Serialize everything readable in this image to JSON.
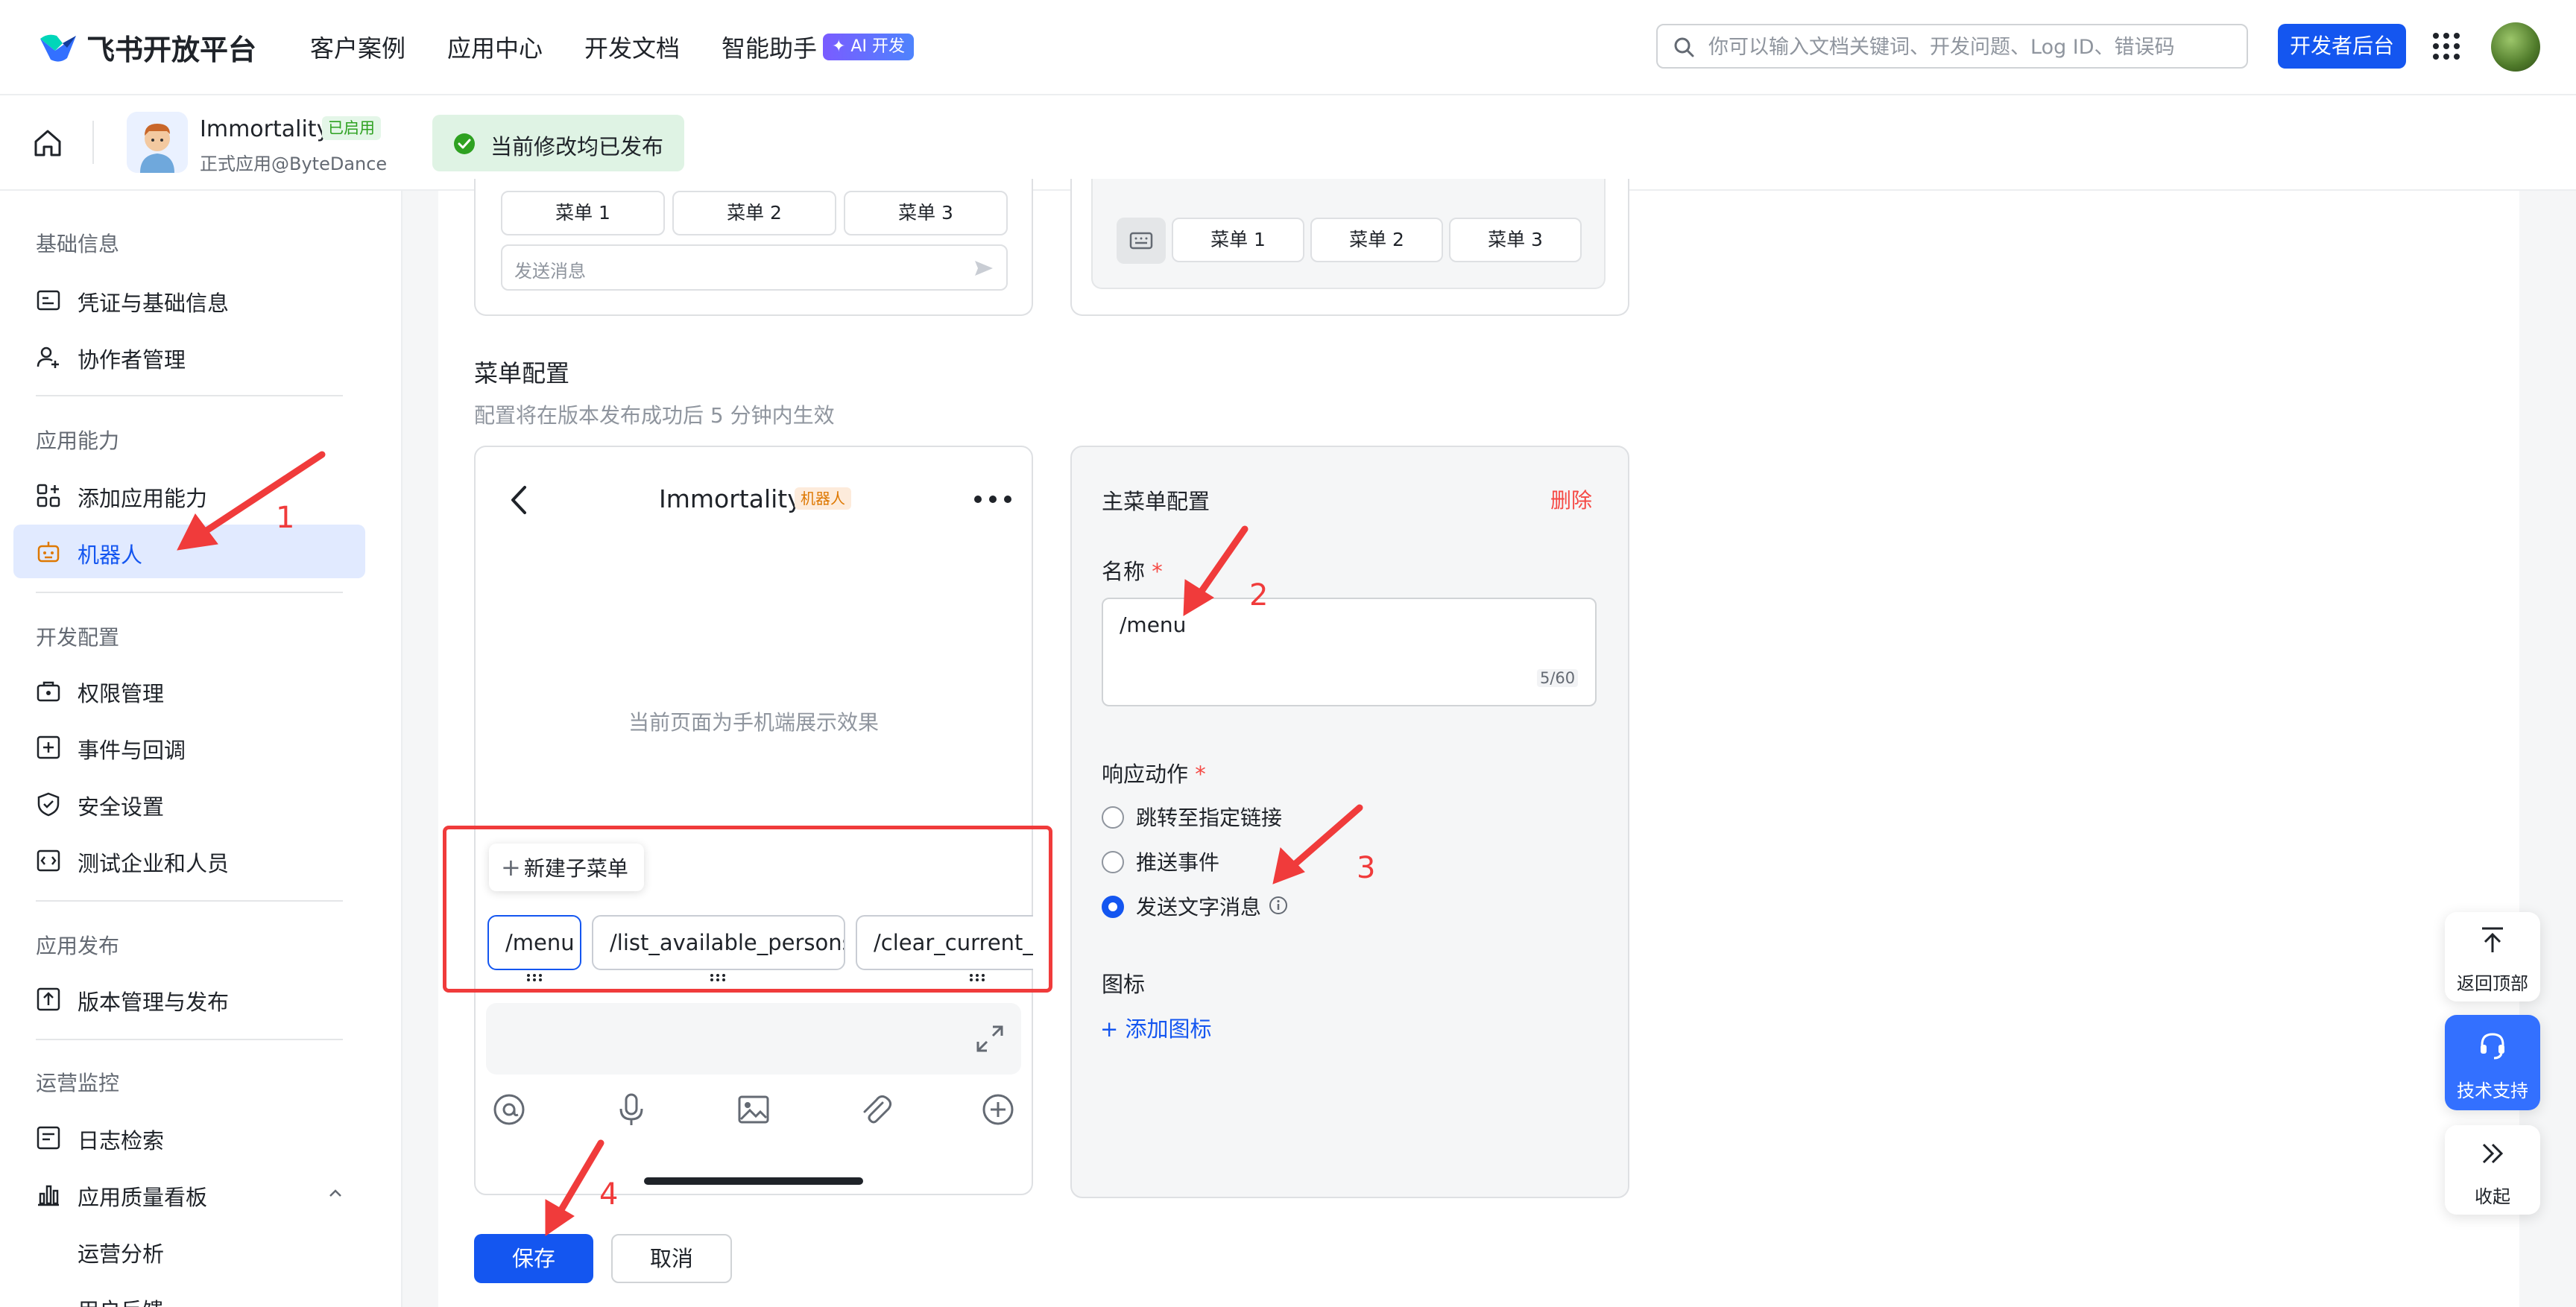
{
  "topnav": {
    "brand": "飞书开放平台",
    "links": [
      "客户案例",
      "应用中心",
      "开发文档",
      "智能助手"
    ],
    "ai_badge": "✦ AI 开发",
    "search_placeholder": "你可以输入文档关键词、开发问题、Log ID、错误码",
    "dev_console": "开发者后台"
  },
  "appbar": {
    "app_name": "Immortality",
    "status": "已启用",
    "subtitle": "正式应用@ByteDance",
    "published_msg": "当前修改均已发布"
  },
  "sidebar": {
    "sections": [
      {
        "title": "基础信息",
        "items": [
          "凭证与基础信息",
          "协作者管理"
        ]
      },
      {
        "title": "应用能力",
        "items": [
          "添加应用能力",
          "机器人"
        ]
      },
      {
        "title": "开发配置",
        "items": [
          "权限管理",
          "事件与回调",
          "安全设置",
          "测试企业和人员"
        ]
      },
      {
        "title": "应用发布",
        "items": [
          "版本管理与发布"
        ]
      },
      {
        "title": "运营监控",
        "items": [
          "日志检索",
          "应用质量看板",
          "运营分析",
          "用户反馈"
        ]
      }
    ],
    "active": "机器人"
  },
  "preview_top": {
    "menus": [
      "菜单 1",
      "菜单 2",
      "菜单 3"
    ],
    "send_placeholder": "发送消息"
  },
  "menu_config": {
    "heading": "菜单配置",
    "description": "配置将在版本发布成功后 5 分钟内生效",
    "phone": {
      "title": "Immortality",
      "bot_tag": "机器人",
      "hint": "当前页面为手机端展示效果",
      "new_submenu": "新建子菜单",
      "chips": [
        "/menu",
        "/list_available_persons",
        "/clear_current_p"
      ]
    },
    "panel": {
      "title": "主菜单配置",
      "delete": "删除",
      "name_label": "名称",
      "name_value": "/menu",
      "counter": "5/60",
      "action_label": "响应动作",
      "actions": [
        "跳转至指定链接",
        "推送事件",
        "发送文字消息"
      ],
      "selected_action": "发送文字消息",
      "icon_label": "图标",
      "add_icon": "添加图标"
    },
    "save": "保存",
    "cancel": "取消"
  },
  "float": {
    "back_top": "返回顶部",
    "support": "技术支持",
    "collapse": "收起"
  },
  "annotations": [
    "1",
    "2",
    "3",
    "4"
  ],
  "colors": {
    "primary": "#1456f0",
    "annotation": "#f03b3b",
    "success": "#2ea121"
  }
}
